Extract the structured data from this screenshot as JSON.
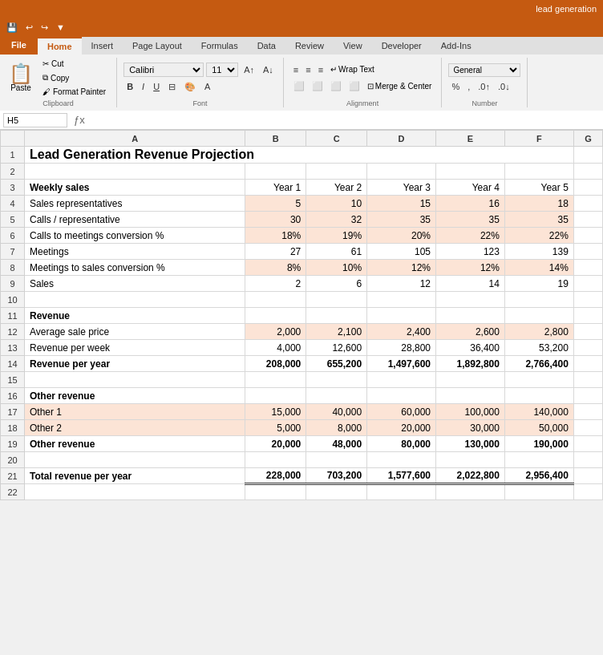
{
  "titlebar": {
    "filename": "lead generation"
  },
  "ribbon": {
    "tabs": [
      "File",
      "Home",
      "Insert",
      "Page Layout",
      "Formulas",
      "Data",
      "Review",
      "View",
      "Developer",
      "Add-Ins"
    ],
    "active_tab": "Home"
  },
  "clipboard": {
    "paste_label": "Paste",
    "cut_label": "✂ Cut",
    "copy_label": "Copy",
    "format_painter_label": "Format Painter",
    "group_label": "Clipboard"
  },
  "font": {
    "face": "Calibri",
    "size": "11",
    "bold": "B",
    "italic": "I",
    "underline": "U",
    "group_label": "Font"
  },
  "alignment": {
    "wrap_text": "Wrap Text",
    "merge_center": "Merge & Center",
    "group_label": "Alignment"
  },
  "number": {
    "format": "General",
    "group_label": "Number"
  },
  "namebox": {
    "cell": "H5"
  },
  "formula_bar": {
    "icon": "ƒx"
  },
  "spreadsheet": {
    "col_headers": [
      "",
      "A",
      "B",
      "C",
      "D",
      "E",
      "F",
      "G"
    ],
    "rows": [
      {
        "num": 1,
        "cells": [
          {
            "text": "Lead Generation Revenue Projection",
            "style": "title bold",
            "colspan": 6
          }
        ]
      },
      {
        "num": 2,
        "cells": []
      },
      {
        "num": 3,
        "cells": [
          {
            "text": "Weekly sales",
            "style": "bold",
            "col": "A"
          },
          {
            "text": "Year 1",
            "style": "right",
            "col": "B"
          },
          {
            "text": "Year 2",
            "style": "right",
            "col": "C"
          },
          {
            "text": "Year 3",
            "style": "right",
            "col": "D"
          },
          {
            "text": "Year 4",
            "style": "right",
            "col": "E"
          },
          {
            "text": "Year 5",
            "style": "right",
            "col": "F"
          }
        ]
      },
      {
        "num": 4,
        "cells": [
          {
            "text": "Sales representatives",
            "col": "A"
          },
          {
            "text": "5",
            "style": "right orange",
            "col": "B"
          },
          {
            "text": "10",
            "style": "right orange",
            "col": "C"
          },
          {
            "text": "15",
            "style": "right orange",
            "col": "D"
          },
          {
            "text": "16",
            "style": "right orange",
            "col": "E"
          },
          {
            "text": "18",
            "style": "right orange",
            "col": "F"
          }
        ]
      },
      {
        "num": 5,
        "cells": [
          {
            "text": "Calls / representative",
            "col": "A"
          },
          {
            "text": "30",
            "style": "right orange",
            "col": "B"
          },
          {
            "text": "32",
            "style": "right orange",
            "col": "C"
          },
          {
            "text": "35",
            "style": "right orange",
            "col": "D"
          },
          {
            "text": "35",
            "style": "right orange",
            "col": "E"
          },
          {
            "text": "35",
            "style": "right orange",
            "col": "F"
          }
        ]
      },
      {
        "num": 6,
        "cells": [
          {
            "text": "Calls to meetings conversion %",
            "col": "A"
          },
          {
            "text": "18%",
            "style": "right orange",
            "col": "B"
          },
          {
            "text": "19%",
            "style": "right orange",
            "col": "C"
          },
          {
            "text": "20%",
            "style": "right orange",
            "col": "D"
          },
          {
            "text": "22%",
            "style": "right orange",
            "col": "E"
          },
          {
            "text": "22%",
            "style": "right orange",
            "col": "F"
          }
        ]
      },
      {
        "num": 7,
        "cells": [
          {
            "text": "Meetings",
            "col": "A"
          },
          {
            "text": "27",
            "style": "right",
            "col": "B"
          },
          {
            "text": "61",
            "style": "right",
            "col": "C"
          },
          {
            "text": "105",
            "style": "right",
            "col": "D"
          },
          {
            "text": "123",
            "style": "right",
            "col": "E"
          },
          {
            "text": "139",
            "style": "right",
            "col": "F"
          }
        ]
      },
      {
        "num": 8,
        "cells": [
          {
            "text": "Meetings to sales conversion %",
            "col": "A"
          },
          {
            "text": "8%",
            "style": "right orange",
            "col": "B"
          },
          {
            "text": "10%",
            "style": "right orange",
            "col": "C"
          },
          {
            "text": "12%",
            "style": "right orange",
            "col": "D"
          },
          {
            "text": "12%",
            "style": "right orange",
            "col": "E"
          },
          {
            "text": "14%",
            "style": "right orange",
            "col": "F"
          }
        ]
      },
      {
        "num": 9,
        "cells": [
          {
            "text": "Sales",
            "col": "A"
          },
          {
            "text": "2",
            "style": "right",
            "col": "B"
          },
          {
            "text": "6",
            "style": "right",
            "col": "C"
          },
          {
            "text": "12",
            "style": "right",
            "col": "D"
          },
          {
            "text": "14",
            "style": "right",
            "col": "E"
          },
          {
            "text": "19",
            "style": "right",
            "col": "F"
          }
        ]
      },
      {
        "num": 10,
        "cells": []
      },
      {
        "num": 11,
        "cells": [
          {
            "text": "Revenue",
            "style": "bold",
            "col": "A"
          }
        ]
      },
      {
        "num": 12,
        "cells": [
          {
            "text": "Average sale price",
            "col": "A"
          },
          {
            "text": "2,000",
            "style": "right orange",
            "col": "B"
          },
          {
            "text": "2,100",
            "style": "right orange",
            "col": "C"
          },
          {
            "text": "2,400",
            "style": "right orange",
            "col": "D"
          },
          {
            "text": "2,600",
            "style": "right orange",
            "col": "E"
          },
          {
            "text": "2,800",
            "style": "right orange",
            "col": "F"
          }
        ]
      },
      {
        "num": 13,
        "cells": [
          {
            "text": "Revenue per week",
            "col": "A"
          },
          {
            "text": "4,000",
            "style": "right",
            "col": "B"
          },
          {
            "text": "12,600",
            "style": "right",
            "col": "C"
          },
          {
            "text": "28,800",
            "style": "right",
            "col": "D"
          },
          {
            "text": "36,400",
            "style": "right",
            "col": "E"
          },
          {
            "text": "53,200",
            "style": "right",
            "col": "F"
          }
        ]
      },
      {
        "num": 14,
        "cells": [
          {
            "text": "Revenue per year",
            "style": "bold",
            "col": "A"
          },
          {
            "text": "208,000",
            "style": "right bold",
            "col": "B"
          },
          {
            "text": "655,200",
            "style": "right bold",
            "col": "C"
          },
          {
            "text": "1,497,600",
            "style": "right bold",
            "col": "D"
          },
          {
            "text": "1,892,800",
            "style": "right bold",
            "col": "E"
          },
          {
            "text": "2,766,400",
            "style": "right bold",
            "col": "F"
          }
        ]
      },
      {
        "num": 15,
        "cells": []
      },
      {
        "num": 16,
        "cells": [
          {
            "text": "Other revenue",
            "style": "bold",
            "col": "A"
          }
        ]
      },
      {
        "num": 17,
        "cells": [
          {
            "text": "Other 1",
            "style": "orange-text",
            "col": "A"
          },
          {
            "text": "15,000",
            "style": "right orange",
            "col": "B"
          },
          {
            "text": "40,000",
            "style": "right orange",
            "col": "C"
          },
          {
            "text": "60,000",
            "style": "right orange",
            "col": "D"
          },
          {
            "text": "100,000",
            "style": "right orange",
            "col": "E"
          },
          {
            "text": "140,000",
            "style": "right orange",
            "col": "F"
          }
        ]
      },
      {
        "num": 18,
        "cells": [
          {
            "text": "Other 2",
            "style": "orange-text",
            "col": "A"
          },
          {
            "text": "5,000",
            "style": "right orange",
            "col": "B"
          },
          {
            "text": "8,000",
            "style": "right orange",
            "col": "C"
          },
          {
            "text": "20,000",
            "style": "right orange",
            "col": "D"
          },
          {
            "text": "30,000",
            "style": "right orange",
            "col": "E"
          },
          {
            "text": "50,000",
            "style": "right orange",
            "col": "F"
          }
        ]
      },
      {
        "num": 19,
        "cells": [
          {
            "text": "Other revenue",
            "style": "bold",
            "col": "A"
          },
          {
            "text": "20,000",
            "style": "right bold",
            "col": "B"
          },
          {
            "text": "48,000",
            "style": "right bold",
            "col": "C"
          },
          {
            "text": "80,000",
            "style": "right bold",
            "col": "D"
          },
          {
            "text": "130,000",
            "style": "right bold",
            "col": "E"
          },
          {
            "text": "190,000",
            "style": "right bold",
            "col": "F"
          }
        ]
      },
      {
        "num": 20,
        "cells": []
      },
      {
        "num": 21,
        "cells": [
          {
            "text": "Total revenue per year",
            "style": "bold",
            "col": "A"
          },
          {
            "text": "228,000",
            "style": "right bold double-border",
            "col": "B"
          },
          {
            "text": "703,200",
            "style": "right bold double-border",
            "col": "C"
          },
          {
            "text": "1,577,600",
            "style": "right bold double-border",
            "col": "D"
          },
          {
            "text": "2,022,800",
            "style": "right bold double-border",
            "col": "E"
          },
          {
            "text": "2,956,400",
            "style": "right bold double-border",
            "col": "F"
          }
        ]
      },
      {
        "num": 22,
        "cells": []
      }
    ]
  }
}
